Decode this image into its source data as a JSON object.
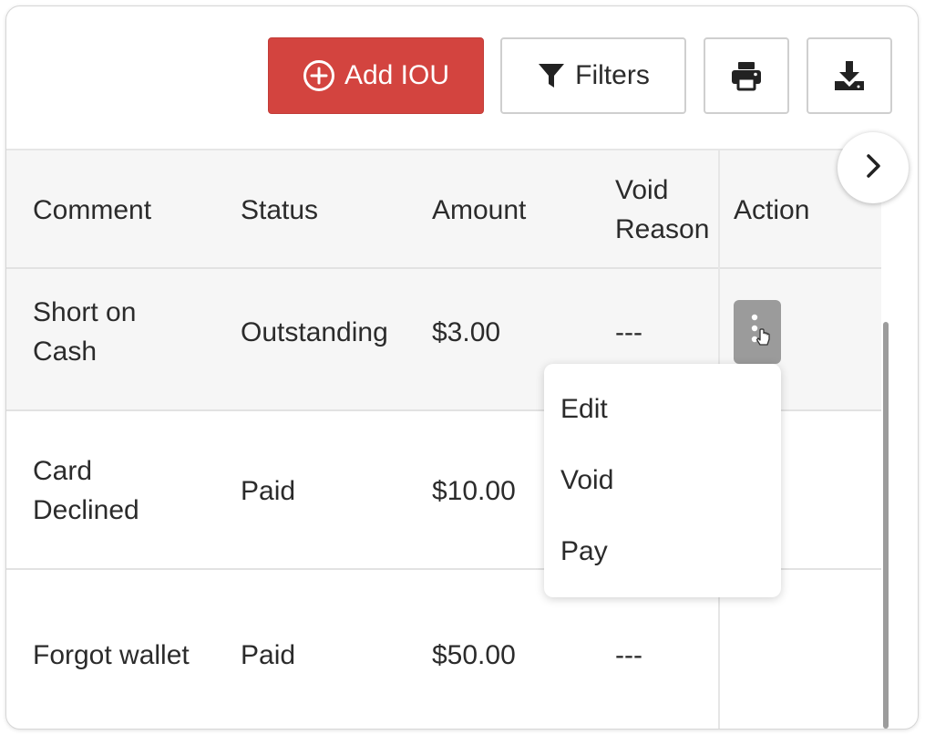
{
  "toolbar": {
    "add_label": "Add IOU",
    "filters_label": "Filters"
  },
  "colors": {
    "primary": "#d3443f",
    "menu_trigger": "#9b9b9b"
  },
  "icons": {
    "add": "plus-circle-icon",
    "filters": "filter-icon",
    "print": "printer-icon",
    "download": "download-icon",
    "next": "chevron-right-icon",
    "kebab": "kebab-vertical-icon",
    "cursor": "pointer-hand-icon"
  },
  "table": {
    "headers": {
      "comment": "Comment",
      "status": "Status",
      "amount": "Amount",
      "void_reason_1": "Void",
      "void_reason_2": "Reason",
      "action": "Action"
    },
    "rows": [
      {
        "comment_1": "Short on",
        "comment_2": "Cash",
        "status": "Outstanding",
        "amount": "$3.00",
        "void_reason": "---"
      },
      {
        "comment_1": "Card",
        "comment_2": "Declined",
        "status": "Paid",
        "amount": "$10.00",
        "void_reason": ""
      },
      {
        "comment_1": "Forgot wallet",
        "comment_2": "",
        "status": "Paid",
        "amount": "$50.00",
        "void_reason": "---"
      }
    ]
  },
  "action_menu": {
    "items": [
      "Edit",
      "Void",
      "Pay"
    ]
  }
}
